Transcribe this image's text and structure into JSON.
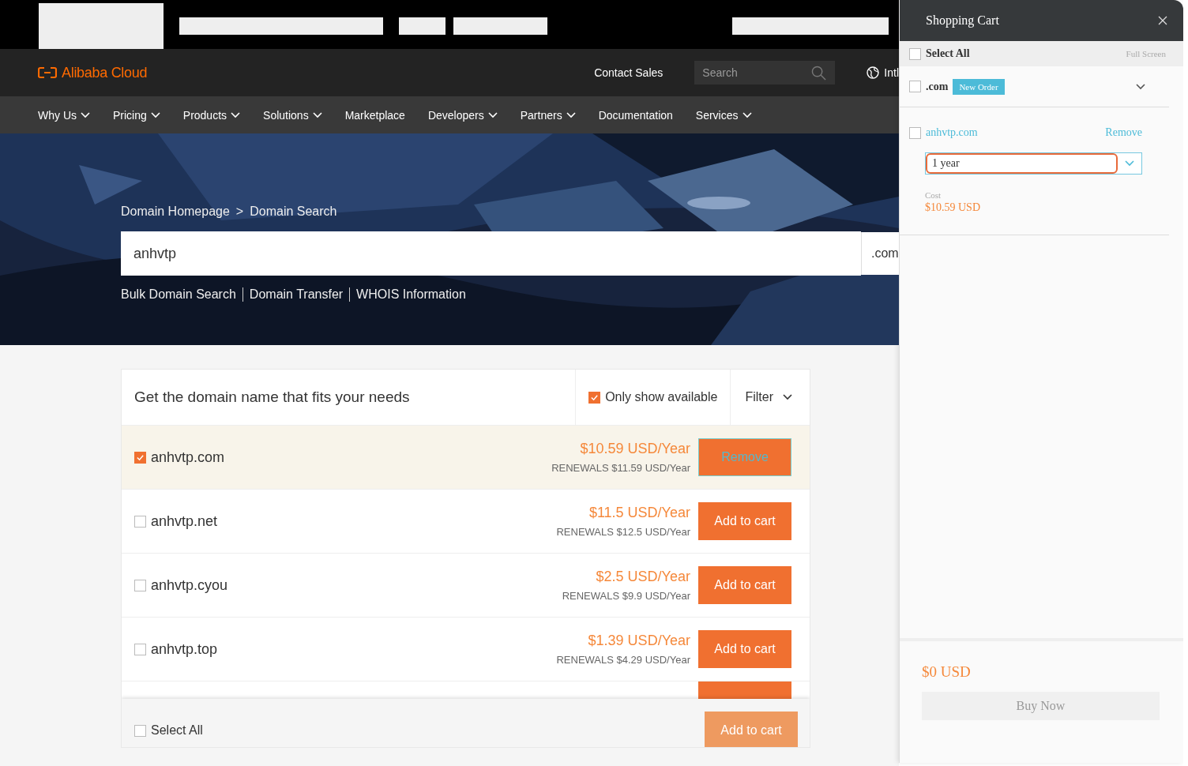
{
  "header": {
    "logo": "Alibaba Cloud",
    "contact": "Contact Sales",
    "search_placeholder": "Search",
    "language": "Intl"
  },
  "nav": [
    {
      "label": "Why Us",
      "dropdown": true
    },
    {
      "label": "Pricing",
      "dropdown": true
    },
    {
      "label": "Products",
      "dropdown": true
    },
    {
      "label": "Solutions",
      "dropdown": true
    },
    {
      "label": "Marketplace",
      "dropdown": false
    },
    {
      "label": "Developers",
      "dropdown": true
    },
    {
      "label": "Partners",
      "dropdown": true
    },
    {
      "label": "Documentation",
      "dropdown": false
    },
    {
      "label": "Services",
      "dropdown": true
    }
  ],
  "hero": {
    "breadcrumb": [
      "Domain Homepage",
      ">",
      "Domain Search"
    ],
    "search_value": "anhvtp",
    "suffix": ".com",
    "links": [
      "Bulk Domain Search",
      "Domain Transfer",
      "WHOIS Information"
    ]
  },
  "results": {
    "title": "Get the domain name that fits your needs",
    "only_available": {
      "label": "Only show available",
      "checked": true
    },
    "filter": "Filter",
    "rows": [
      {
        "domain": "anhvtp.com",
        "checked": true,
        "price": "$10.59 USD/Year",
        "renewal": "RENEWALS $11.59 USD/Year",
        "action": "Remove"
      },
      {
        "domain": "anhvtp.net",
        "checked": false,
        "price": "$11.5 USD/Year",
        "renewal": "RENEWALS $12.5 USD/Year",
        "action": "Add to cart"
      },
      {
        "domain": "anhvtp.cyou",
        "checked": false,
        "price": "$2.5 USD/Year",
        "renewal": "RENEWALS $9.9 USD/Year",
        "action": "Add to cart"
      },
      {
        "domain": "anhvtp.top",
        "checked": false,
        "price": "$1.39 USD/Year",
        "renewal": "RENEWALS $4.29 USD/Year",
        "action": "Add to cart"
      }
    ],
    "select_all": {
      "label": "Select All",
      "checked": false
    },
    "add_button": {
      "label": "Add to cart",
      "disabled": true
    }
  },
  "cart": {
    "title": "Shopping Cart",
    "select_all": {
      "label": "Select All",
      "checked": false
    },
    "full_screen": "Full Screen",
    "group": {
      "label": ".com",
      "badge": "New Order",
      "checked": false
    },
    "items": [
      {
        "domain": "anhvtp.com",
        "checked": false,
        "remove": "Remove",
        "term": "1 year",
        "cost_label": "Cost",
        "cost": "$10.59 USD"
      }
    ],
    "total": "$0 USD",
    "buy": "Buy Now"
  }
}
